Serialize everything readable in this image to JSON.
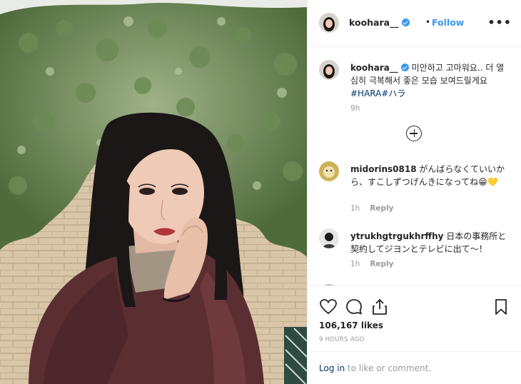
{
  "header": {
    "username": "koohara__",
    "separator": "•",
    "follow_label": "Follow",
    "more_label": "•••"
  },
  "caption": {
    "username": "koohara__",
    "text": "미안하고 고마워요.. 더 열심히 극복해서 좋은 모습 보여드릴게요",
    "hashtags": "#HARA#ハラ",
    "time": "9h"
  },
  "comments": [
    {
      "username": "midorins0818",
      "text": "がんばらなくていいから、すこしずつげんきになってね😁💛",
      "time": "1h",
      "reply_label": "Reply"
    },
    {
      "username": "ytrukhgtrgukhrffhy",
      "text": "日本の事務所と契約してジヨンとテレビに出て〜！",
      "time": "1h",
      "reply_label": "Reply"
    }
  ],
  "actions": {
    "likes": "106,167 likes",
    "posted": "9 HOURS AGO",
    "login_label": "Log in",
    "login_suffix": " to like or comment."
  },
  "icons": {
    "like": "heart-icon",
    "comment": "comment-bubble-icon",
    "share": "share-icon",
    "save": "bookmark-icon",
    "load_more": "plus-circle-icon",
    "verified": "verified-badge-icon",
    "more": "more-options-icon"
  },
  "colors": {
    "link_blue": "#3897f0",
    "hashtag": "#003569",
    "muted": "#999999",
    "border": "#efefef"
  }
}
